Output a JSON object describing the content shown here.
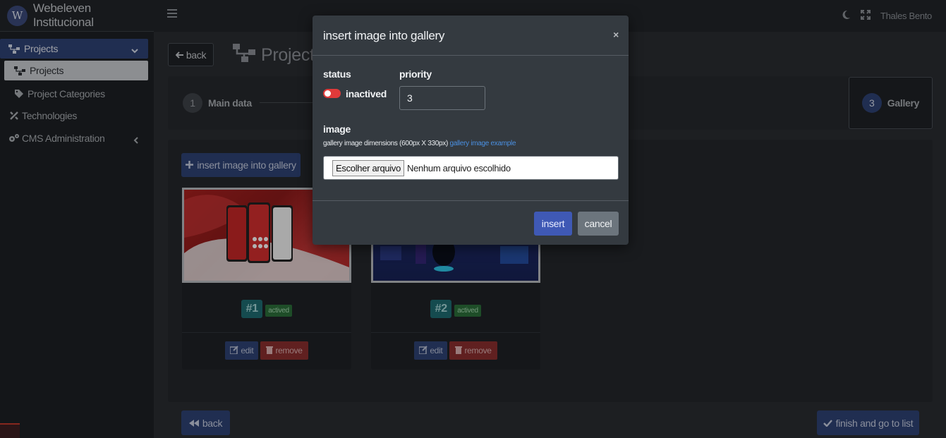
{
  "app": {
    "title": "Webeleven Institucional",
    "logo_letter": "W",
    "user": "Thales Bento"
  },
  "sidebar": {
    "items": [
      {
        "label": "Projects",
        "icon": "sitemap-icon",
        "active": true
      },
      {
        "label": "Projects",
        "icon": "sitemap-icon",
        "sub": true,
        "active": true
      },
      {
        "label": "Project Categories",
        "icon": "tag-icon",
        "sub": true
      },
      {
        "label": "Technologies",
        "icon": "tools-icon"
      },
      {
        "label": "CMS Administration",
        "icon": "cogs-icon"
      }
    ]
  },
  "page": {
    "back": "back",
    "title": "Projects"
  },
  "steps": [
    {
      "num": "1",
      "label": "Main data"
    },
    {
      "num": "3",
      "label": "Gallery"
    }
  ],
  "gallery": {
    "insert_label": "insert image into gallery",
    "items": [
      {
        "index": "#1",
        "status": "actived",
        "edit": "edit",
        "remove": "remove"
      },
      {
        "index": "#2",
        "status": "actived",
        "edit": "edit",
        "remove": "remove"
      }
    ]
  },
  "footer": {
    "back": "back",
    "finish": "finish and go to list"
  },
  "modal": {
    "title": "insert image into gallery",
    "close": "×",
    "status_label": "status",
    "status_value": "inactived",
    "priority_label": "priority",
    "priority_value": "3",
    "image_label": "image",
    "hint": "gallery image dimensions (600px X 330px)",
    "hint_link": "gallery image example",
    "file_button": "Escolher arquivo",
    "file_status": "Nenhum arquivo escolhido",
    "insert": "insert",
    "cancel": "cancel"
  },
  "colors": {
    "primary": "#2f4275",
    "danger": "#8a2e2e",
    "success": "#2b6f3a",
    "toggle_off": "#e03a3a",
    "link": "#4a8fe0"
  }
}
